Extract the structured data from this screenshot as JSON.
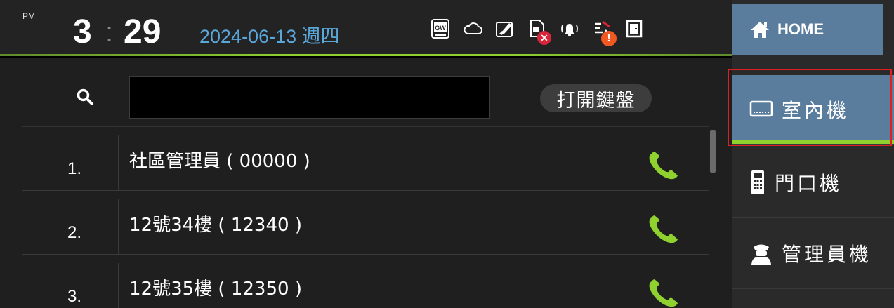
{
  "status_bar": {
    "ampm": "PM",
    "hour": "3",
    "colon": ":",
    "minute": "29",
    "date": "2024-06-13 週四",
    "icons": [
      "gw-icon",
      "cloud-icon",
      "clean-icon",
      "sim-error-icon",
      "bell-ringing-icon",
      "network-warning-icon",
      "door-icon"
    ],
    "gw_label": "GW",
    "error_badge": "✕",
    "warning_badge": "!"
  },
  "search": {
    "value": "",
    "placeholder": ""
  },
  "keyboard_button": {
    "label": "打開鍵盤"
  },
  "contacts": [
    {
      "index": "1.",
      "name": "社區管理員 ( 00000 )"
    },
    {
      "index": "2.",
      "name": "12號34樓 ( 12340 )"
    },
    {
      "index": "3.",
      "name": "12號35樓 ( 12350 )"
    }
  ],
  "sidebar": {
    "home_label": "HOME",
    "items": [
      {
        "label": "室內機",
        "icon": "indoor-monitor-icon",
        "active": true
      },
      {
        "label": "門口機",
        "icon": "door-station-icon",
        "active": false
      },
      {
        "label": "管理員機",
        "icon": "guard-icon",
        "active": false
      }
    ]
  },
  "colors": {
    "accent_blue": "#5a7d9e",
    "accent_green": "#8fd12f",
    "date_blue": "#5aa7db",
    "call_green": "#8fd12f",
    "error_red": "#d8253a",
    "warning_orange": "#f05a22"
  }
}
